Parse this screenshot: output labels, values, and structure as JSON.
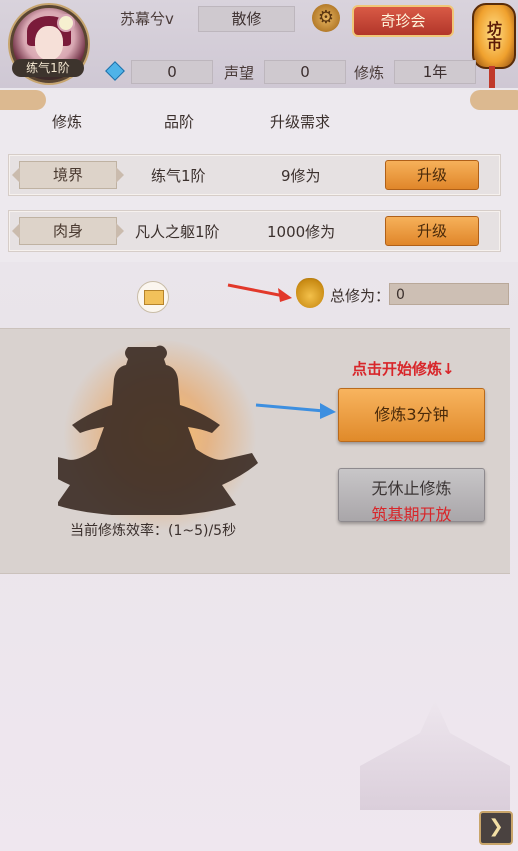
{
  "header": {
    "avatar_rank": "练气1阶",
    "player_name": "苏幕兮v",
    "sect": "散修",
    "qizhen_label": "奇珍会",
    "market_label": "坊市",
    "gems": "0",
    "reputation_label": "声望",
    "reputation_value": "0",
    "cultivation_label": "修炼",
    "cultivation_value": "1年"
  },
  "table": {
    "headers": [
      "修炼",
      "品阶",
      "升级需求"
    ],
    "rows": [
      {
        "name": "境界",
        "grade": "练气1阶",
        "requirement": "9修为",
        "button": "升级"
      },
      {
        "name": "肉身",
        "grade": "凡人之躯1阶",
        "requirement": "1000修为",
        "button": "升级"
      }
    ]
  },
  "total": {
    "label": "总修为：",
    "value": "0"
  },
  "meditation": {
    "hint": "点击开始修炼↓",
    "button_3min": "修炼3分钟",
    "endless_line1": "无休止修炼",
    "endless_line2": "筑基期开放",
    "efficiency": "当前修炼效率：(1~5)/5秒"
  },
  "icons": {
    "settings": "gear-icon",
    "mail": "mail-icon",
    "bag": "money-bag-icon",
    "next": "chevron-right-icon"
  },
  "colors": {
    "accent_orange": "#e8952f",
    "hint_red": "#d8262a",
    "arrow_red": "#e2382a",
    "arrow_blue": "#3d8fe0"
  }
}
